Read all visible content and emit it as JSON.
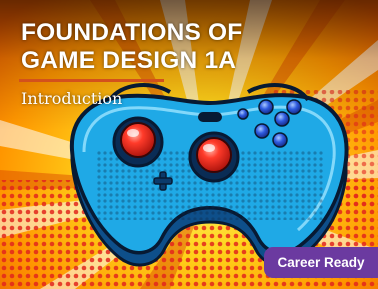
{
  "course": {
    "title_line1": "FOUNDATIONS OF",
    "title_line2": "GAME DESIGN 1A",
    "subtitle": "Introduction"
  },
  "badge": {
    "label": "Career Ready"
  },
  "colors": {
    "accent_rule": "#d3511c",
    "badge_bg": "#6b3aa0",
    "controller_blue": "#1fa9e6",
    "background_orange": "#ff8a00",
    "background_yellow": "#ffe63a"
  },
  "illustration": {
    "subject": "pop-art-game-controller",
    "icons": [
      "game-controller-icon",
      "joystick-icon",
      "action-buttons-icon"
    ]
  }
}
